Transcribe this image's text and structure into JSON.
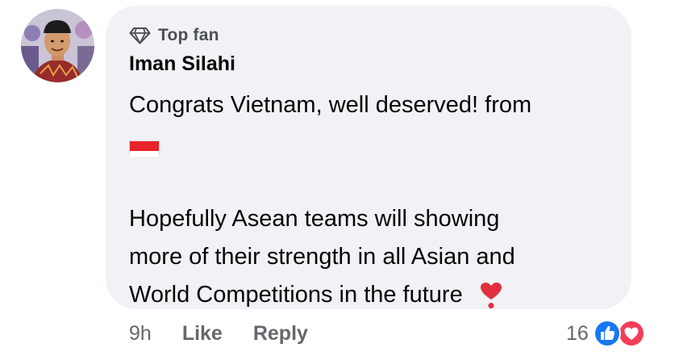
{
  "comment": {
    "badge_label": "Top fan",
    "author": "Iman Silahi",
    "lines": {
      "l1": "Congrats Vietnam, well deserved! from",
      "l3": "Hopefully Asean teams will showing",
      "l4": "more of their strength in all Asian and",
      "l5": "World Competitions in the future"
    },
    "emojis": {
      "flag": "indonesia-flag",
      "heart": "heavy-heart-exclamation"
    }
  },
  "actions": {
    "time": "9h",
    "like_label": "Like",
    "reply_label": "Reply"
  },
  "reactions": {
    "count": "16",
    "types": [
      "like",
      "love"
    ]
  },
  "colors": {
    "bubble": "#f0f2f5",
    "like_blue": "#1877f2",
    "love_red": "#f33e58",
    "secondary_text": "#65676b"
  }
}
